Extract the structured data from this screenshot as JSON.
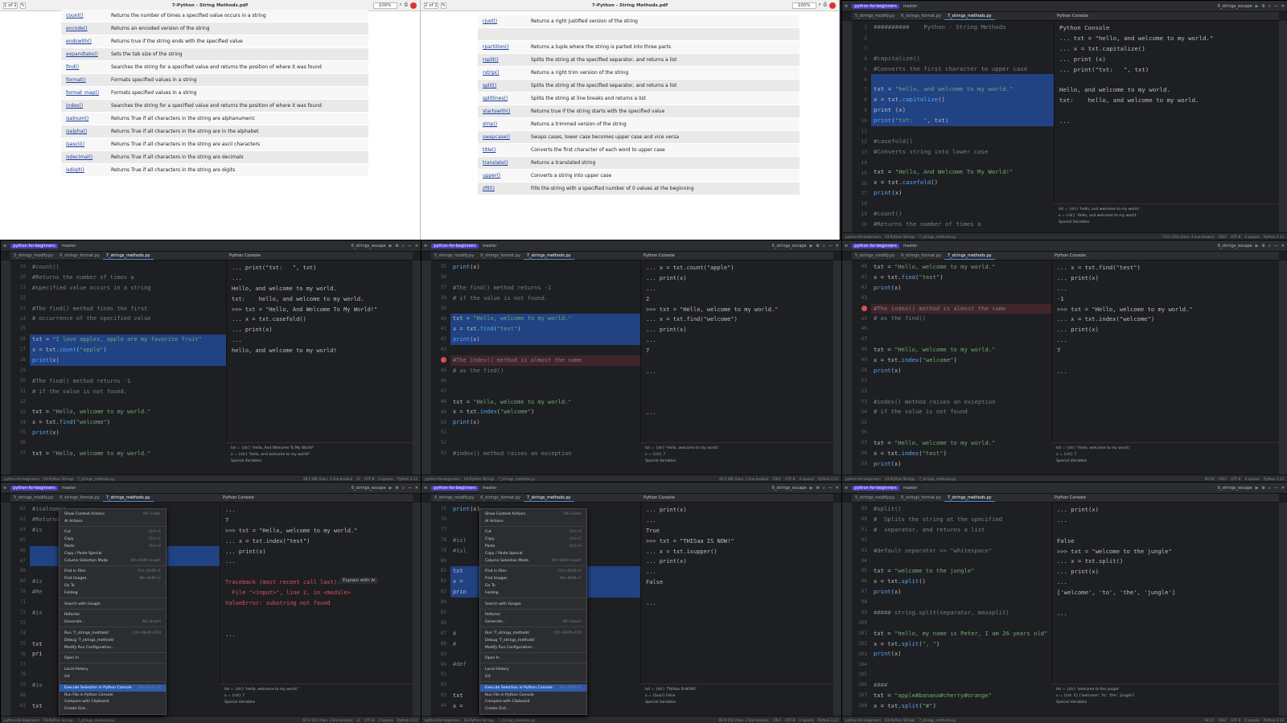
{
  "pdf1": {
    "title": "7-Python - String Methods.pdf",
    "zoom": "100%",
    "page": "1 of 2",
    "methods": [
      [
        "count()",
        "Returns the number of times a specified value occurs in a string"
      ],
      [
        "encode()",
        "Returns an encoded version of the string"
      ],
      [
        "endswith()",
        "Returns true if the string ends with the specified value"
      ],
      [
        "expandtabs()",
        "Sets the tab size of the string"
      ],
      [
        "find()",
        "Searches the string for a specified value and returns the position of where it was found"
      ],
      [
        "format()",
        "Formats specified values in a string"
      ],
      [
        "format_map()",
        "Formats specified values in a string"
      ],
      [
        "index()",
        "Searches the string for a specified value and returns the position of where it was found"
      ],
      [
        "isalnum()",
        "Returns True if all characters in the string are alphanumeric"
      ],
      [
        "isalpha()",
        "Returns True if all characters in the string are in the alphabet"
      ],
      [
        "isascii()",
        "Returns True if all characters in the string are ascii characters"
      ],
      [
        "isdecimal()",
        "Returns True if all characters in the string are decimals"
      ],
      [
        "isdigit()",
        "Returns True if all characters in the string are digits"
      ]
    ]
  },
  "pdf2": {
    "title": "7-Python - String Methods.pdf",
    "zoom": "100%",
    "page": "2 of 2",
    "methods": [
      [
        "rjust()",
        "Returns a right justified version of the string"
      ],
      [
        "",
        ""
      ],
      [
        "rpartition()",
        "Returns a tuple where the string is parted into three parts"
      ],
      [
        "rsplit()",
        "Splits the string at the specified separator, and returns a list"
      ],
      [
        "rstrip()",
        "Returns a right trim version of the string"
      ],
      [
        "split()",
        "Splits the string at the specified separator, and returns a list"
      ],
      [
        "splitlines()",
        "Splits the string at line breaks and returns a list"
      ],
      [
        "startswith()",
        "Returns true if the string starts with the specified value"
      ],
      [
        "strip()",
        "Returns a trimmed version of the string"
      ],
      [
        "swapcase()",
        "Swaps cases, lower case becomes upper case and vice versa"
      ],
      [
        "title()",
        "Converts the first character of each word to upper case"
      ],
      [
        "translate()",
        "Returns a translated string"
      ],
      [
        "upper()",
        "Converts a string into upper case"
      ],
      [
        "zfill()",
        "Fills the string with a specified number of 0 values at the beginning"
      ]
    ]
  },
  "ide_common": {
    "project": "python-for-beginners",
    "branch": "master",
    "run_config": "6_strings_escape",
    "tabs": [
      "5_strings_modify.py",
      "6_strings_format.py",
      "7_strings_methods.py"
    ],
    "console_tab": "Python Console",
    "special_vars": "Special Variables"
  },
  "panel1": {
    "lines": [
      {
        "n": "1",
        "t": "##########    Python - String Methods",
        "c": "cmt"
      },
      {
        "n": "2",
        "t": ""
      },
      {
        "n": "3",
        "t": ""
      },
      {
        "n": "4",
        "t": "#capitalize()",
        "c": "cmt"
      },
      {
        "n": "5",
        "t": "#Converts the first character to upper case",
        "c": "cmt"
      },
      {
        "n": "6",
        "t": "",
        "s": 1
      },
      {
        "n": "7",
        "t": "txt = \"hello, and welcome to my world.\"",
        "s": 1
      },
      {
        "n": "8",
        "t": "x = txt.capitalize()",
        "s": 1
      },
      {
        "n": "9",
        "t": "print (x)",
        "s": 1
      },
      {
        "n": "10",
        "t": "print(\"txt:   \", txt)",
        "s": 1
      },
      {
        "n": "11",
        "t": ""
      },
      {
        "n": "12",
        "t": "#casefold()",
        "c": "cmt"
      },
      {
        "n": "13",
        "t": "#Converts string into lower case",
        "c": "cmt"
      },
      {
        "n": "14",
        "t": ""
      },
      {
        "n": "15",
        "t": "txt = \"Hello, And Welcome To My World!\""
      },
      {
        "n": "16",
        "t": "x = txt.casefold()"
      },
      {
        "n": "17",
        "t": "print(x)"
      },
      {
        "n": "18",
        "t": ""
      },
      {
        "n": "19",
        "t": "#count()",
        "c": "cmt"
      },
      {
        "n": "20",
        "t": "#Returns the number of times a",
        "c": "cmt"
      }
    ],
    "console": [
      "Python Console",
      "... txt = \"hello, and welcome to my world.\"",
      "... x = txt.capitalize()",
      "... print (x)",
      "... print(\"txt:   \", txt)",
      "",
      "Hello, and welcome to my world.",
      "txt:    hello, and welcome to my world.",
      "",
      "..."
    ],
    "vars": [
      "txt = {str} 'hello, and welcome to my world.'",
      "x = {str} 'Hello, and welcome to my world.'",
      "Special Variables"
    ],
    "status": [
      "python-for-beginners",
      "03-Python Strings",
      "7_strings_methods.py",
      "7:52 (163 chars, 4 line breaks)",
      "CRLF",
      "UTF-8",
      "4 spaces",
      "Python 3.12"
    ]
  },
  "panel2": {
    "lines": [
      {
        "n": "19",
        "t": "#count()",
        "c": "cmt"
      },
      {
        "n": "20",
        "t": "#Returns the number of times a",
        "c": "cmt"
      },
      {
        "n": "21",
        "t": "#specified value occurs in a string",
        "c": "cmt"
      },
      {
        "n": "22",
        "t": ""
      },
      {
        "n": "23",
        "t": "#The find() method finds the first",
        "c": "cmt"
      },
      {
        "n": "24",
        "t": "# occurrence of the specified value",
        "c": "cmt"
      },
      {
        "n": "25",
        "t": ""
      },
      {
        "n": "26",
        "t": "txt = \"I love apples, apple are my favorite fruit\"",
        "s": 1
      },
      {
        "n": "27",
        "t": "x = txt.count(\"apple\")",
        "s": 1
      },
      {
        "n": "28",
        "t": "print(x)",
        "s": 1
      },
      {
        "n": "29",
        "t": ""
      },
      {
        "n": "30",
        "t": "#The find() method returns -1",
        "c": "cmt"
      },
      {
        "n": "31",
        "t": "# if the value is not found.",
        "c": "cmt"
      },
      {
        "n": "32",
        "t": ""
      },
      {
        "n": "33",
        "t": "txt = \"Hello, welcome to my world.\""
      },
      {
        "n": "34",
        "t": "x = txt.find(\"welcome\")"
      },
      {
        "n": "35",
        "t": "print(x)"
      },
      {
        "n": "36",
        "t": ""
      },
      {
        "n": "37",
        "t": "txt = \"Hello, welcome to my world.\""
      }
    ],
    "console": [
      "... print(\"txt:   \", txt)",
      "...",
      "Hello, and welcome to my world.",
      "txt:    hello, and welcome to my world.",
      ">>> txt = \"Hello, And Welcome To My World!\"",
      "... x = txt.casefold()",
      "... print(x)",
      "...",
      "hello, and welcome to my world!"
    ],
    "vars": [
      "txt = {str} 'Hello, And Welcome To My World!'",
      "x = {str} 'hello, and welcome to my world!'",
      "Special Variables"
    ],
    "status": [
      "python-for-beginners",
      "03-Python Strings",
      "7_strings_methods.py",
      "28:1 (80 chars, 3 line breaks)",
      "LF",
      "UTF-8",
      "4 spaces",
      "Python 3.12"
    ]
  },
  "panel3": {
    "lines": [
      {
        "n": "35",
        "t": "print(x)"
      },
      {
        "n": "36",
        "t": ""
      },
      {
        "n": "37",
        "t": "#The find() method returns -1",
        "c": "cmt"
      },
      {
        "n": "38",
        "t": "# if the value is not found.",
        "c": "cmt"
      },
      {
        "n": "39",
        "t": ""
      },
      {
        "n": "40",
        "t": "txt = \"Hello, welcome to my world.\"",
        "s": 1
      },
      {
        "n": "41",
        "t": "x = txt.find(\"test\")",
        "s": 1
      },
      {
        "n": "42",
        "t": "print(x)",
        "s": 1
      },
      {
        "n": "43",
        "t": ""
      },
      {
        "n": "44",
        "t": "#The index() method is almost the same",
        "c": "cmt",
        "b": 1
      },
      {
        "n": "45",
        "t": "# as the find()",
        "c": "cmt"
      },
      {
        "n": "46",
        "t": ""
      },
      {
        "n": "47",
        "t": ""
      },
      {
        "n": "48",
        "t": "txt = \"Hello, welcome to my world.\""
      },
      {
        "n": "49",
        "t": "x = txt.index(\"welcome\")"
      },
      {
        "n": "50",
        "t": "print(x)"
      },
      {
        "n": "51",
        "t": ""
      },
      {
        "n": "52",
        "t": ""
      },
      {
        "n": "53",
        "t": "#index() method raises an exception",
        "c": "cmt"
      }
    ],
    "console": [
      "... x = txt.count(\"apple\")",
      "... print(x)",
      "...",
      "2",
      ">>> txt = \"Hello, welcome to my world.\"",
      "... x = txt.find(\"welcome\")",
      "... print(x)",
      "...",
      "7",
      "",
      "...",
      "",
      "",
      "",
      "..."
    ],
    "vars": [
      "txt = {str} 'Hello, welcome to my world.'",
      "x = {int} 7",
      "Special Variables"
    ],
    "status": [
      "python-for-beginners",
      "03-Python Strings",
      "7_strings_methods.py",
      "40:1 (80 chars, 3 line breaks)",
      "CRLF",
      "UTF-8",
      "4 spaces",
      "Python 3.12"
    ]
  },
  "panel4": {
    "lines": [
      {
        "n": "40",
        "t": "txt = \"Hello, welcome to my world.\""
      },
      {
        "n": "41",
        "t": "x = txt.find(\"test\")"
      },
      {
        "n": "42",
        "t": "print(x)"
      },
      {
        "n": "43",
        "t": ""
      },
      {
        "n": "44",
        "t": "#The index() method is almost the same",
        "c": "cmt",
        "b": 1
      },
      {
        "n": "45",
        "t": "# as the find()",
        "c": "cmt"
      },
      {
        "n": "46",
        "t": ""
      },
      {
        "n": "47",
        "t": ""
      },
      {
        "n": "48",
        "t": "txt = \"Hello, welcome to my world.\""
      },
      {
        "n": "49",
        "t": "x = txt.index(\"welcome\")"
      },
      {
        "n": "50",
        "t": "print(x)"
      },
      {
        "n": "51",
        "t": ""
      },
      {
        "n": "52",
        "t": ""
      },
      {
        "n": "53",
        "t": "#index() method raises an exception",
        "c": "cmt"
      },
      {
        "n": "54",
        "t": "# if the value is not found",
        "c": "cmt"
      },
      {
        "n": "55",
        "t": ""
      },
      {
        "n": "56",
        "t": ""
      },
      {
        "n": "57",
        "t": "txt = \"Hello, welcome to my world.\""
      },
      {
        "n": "58",
        "t": "x = txt.index(\"test\")"
      },
      {
        "n": "59",
        "t": "print(x)"
      }
    ],
    "console": [
      "... x = txt.find(\"test\")",
      "... print(x)",
      "...",
      "-1",
      ">>> txt = \"Hello, welcome to my world.\"",
      "... x = txt.index(\"welcome\")",
      "... print(x)",
      "...",
      "7",
      "",
      "..."
    ],
    "vars": [
      "txt = {str} 'Hello, welcome to my world.'",
      "x = {int} 7",
      "Special Variables"
    ],
    "status": [
      "python-for-beginners",
      "03-Python Strings",
      "7_strings_methods.py",
      "49:18",
      "CRLF",
      "UTF-8",
      "4 spaces",
      "Python 3.12"
    ]
  },
  "panel5": {
    "lines": [
      {
        "n": "62",
        "t": "#isalnum()",
        "c": "cmt"
      },
      {
        "n": "63",
        "t": "#Returns True",
        "c": "cmt"
      },
      {
        "n": "64",
        "t": "#is",
        "c": "cmt"
      },
      {
        "n": "65",
        "t": ""
      },
      {
        "n": "66",
        "t": "",
        "s": 1
      },
      {
        "n": "67",
        "t": "",
        "s": 1
      },
      {
        "n": "68",
        "t": ""
      },
      {
        "n": "69",
        "t": "#is",
        "c": "cmt"
      },
      {
        "n": "70",
        "t": "#Re",
        "c": "cmt"
      },
      {
        "n": "71",
        "t": ""
      },
      {
        "n": "72",
        "t": "#is",
        "c": "cmt"
      },
      {
        "n": "73",
        "t": ""
      },
      {
        "n": "74",
        "t": ""
      },
      {
        "n": "75",
        "t": "txt"
      },
      {
        "n": "76",
        "t": "pri"
      },
      {
        "n": "77",
        "t": ""
      },
      {
        "n": "78",
        "t": ""
      },
      {
        "n": "79",
        "t": "#is",
        "c": "cmt"
      },
      {
        "n": "80",
        "t": ""
      },
      {
        "n": "81",
        "t": "txt"
      }
    ],
    "console": [
      "...",
      "7",
      ">>> txt = \"Hello, welcome to my world.\"",
      "... x = txt.index(\"test\")",
      "... print(x)",
      "...",
      "",
      "Traceback (most recent call last):",
      "  File \"<input>\", line 2, in <module>",
      "ValueError: substring not found",
      "",
      "",
      "...",
      ""
    ],
    "explain": "Explain with AI",
    "vars": [
      "txt = {str} 'Hello, welcome to my world.'",
      "x = {int} 7",
      "Special Variables"
    ],
    "status": [
      "python-for-beginners",
      "03-Python Strings",
      "7_strings_methods.py",
      "67:4 (41 chars, 3 line breaks)",
      "LF",
      "UTF-8",
      "4 spaces",
      "Python 3.12"
    ]
  },
  "panel6": {
    "lines": [
      {
        "n": "75",
        "t": "print(x)"
      },
      {
        "n": "76",
        "t": ""
      },
      {
        "n": "77",
        "t": ""
      },
      {
        "n": "78",
        "t": "#isl",
        "c": "cmt"
      },
      {
        "n": "79",
        "t": "#isl",
        "c": "cmt"
      },
      {
        "n": "80",
        "t": ""
      },
      {
        "n": "81",
        "t": "txt",
        "s": 1
      },
      {
        "n": "82",
        "t": "x =",
        "s": 1
      },
      {
        "n": "83",
        "t": "prin",
        "s": 1
      },
      {
        "n": "84",
        "t": ""
      },
      {
        "n": "85",
        "t": ""
      },
      {
        "n": "86",
        "t": ""
      },
      {
        "n": "87",
        "t": "# ",
        "c": "cmt"
      },
      {
        "n": "88",
        "t": "#",
        "c": "cmt"
      },
      {
        "n": "89",
        "t": ""
      },
      {
        "n": "90",
        "t": "#def",
        "c": "cmt"
      },
      {
        "n": "91",
        "t": ""
      },
      {
        "n": "92",
        "t": ""
      },
      {
        "n": "93",
        "t": "txt"
      },
      {
        "n": "94",
        "t": "x ="
      }
    ],
    "console": [
      "... print(x)",
      "...",
      "True",
      ">>> txt = \"THISaa IS NOW!\"",
      "... x = txt.isupper()",
      "... print(x)",
      "...",
      "False",
      "",
      "..."
    ],
    "vars": [
      "txt = {str} 'THISaa IS NOW!'",
      "x = {bool} False",
      "Special Variables"
    ],
    "status": [
      "python-for-beginners",
      "03-Python Strings",
      "7_strings_methods.py",
      "83:9 (54 chars, 2 line breaks)",
      "CRLF",
      "UTF-8",
      "4 spaces",
      "Python 3.12"
    ]
  },
  "panel7": {
    "lines": [
      {
        "n": "89",
        "t": "#split()",
        "c": "cmt"
      },
      {
        "n": "90",
        "t": "#  Splits the string at the specified",
        "c": "cmt"
      },
      {
        "n": "91",
        "t": "#  separator, and returns a list",
        "c": "cmt"
      },
      {
        "n": "92",
        "t": ""
      },
      {
        "n": "93",
        "t": "#default separator => \"whitespace\"",
        "c": "cmt"
      },
      {
        "n": "94",
        "t": ""
      },
      {
        "n": "95",
        "t": "txt = \"welcome to the jungle\""
      },
      {
        "n": "96",
        "t": "x = txt.split()"
      },
      {
        "n": "97",
        "t": "print(x)"
      },
      {
        "n": "98",
        "t": ""
      },
      {
        "n": "99",
        "t": "##### string.split(separator, maxsplit)",
        "c": "cmt"
      },
      {
        "n": "100",
        "t": ""
      },
      {
        "n": "101",
        "t": "txt = \"hello, my name is Peter, I am 26 years old\""
      },
      {
        "n": "102",
        "t": "x = txt.split(\", \")"
      },
      {
        "n": "103",
        "t": "print(x)"
      },
      {
        "n": "104",
        "t": ""
      },
      {
        "n": "105",
        "t": ""
      },
      {
        "n": "106",
        "t": "####",
        "c": "cmt"
      },
      {
        "n": "107",
        "t": "txt = \"apple#banana#cherry#orange\""
      },
      {
        "n": "108",
        "t": "x = txt.split(\"#\")"
      }
    ],
    "console": [
      "... print(x)",
      "...",
      "",
      "False",
      ">>> txt = \"welcome to the jungle\"",
      "... x = txt.split()",
      "... print(x)",
      "...",
      "['welcome', 'to', 'the', 'jungle']",
      "",
      "..."
    ],
    "vars": [
      "txt = {str} 'welcome to the jungle'",
      "x = {list: 4} ['welcome', 'to', 'the', 'jungle']",
      "Special Variables"
    ],
    "status": [
      "python-for-beginners",
      "03-Python Strings",
      "7_strings_methods.py",
      "94:15",
      "CRLF",
      "UTF-8",
      "4 spaces",
      "Python 3.12"
    ]
  },
  "menu": [
    {
      "l": "Show Context Actions",
      "k": "Alt+Enter"
    },
    {
      "l": "AI Actions",
      "k": ""
    },
    {
      "l": "",
      "k": ""
    },
    {
      "l": "Cut",
      "k": "Ctrl+X"
    },
    {
      "l": "Copy",
      "k": "Ctrl+C"
    },
    {
      "l": "Paste",
      "k": "Ctrl+V"
    },
    {
      "l": "Copy / Paste Special",
      "k": ""
    },
    {
      "l": "Column Selection Mode",
      "k": "Alt+Shift+Insert"
    },
    {
      "l": "",
      "k": ""
    },
    {
      "l": "Find in Files",
      "k": "Ctrl+Shift+F"
    },
    {
      "l": "Find Usages",
      "k": "Alt+Shift+7"
    },
    {
      "l": "Go To",
      "k": ""
    },
    {
      "l": "Folding",
      "k": ""
    },
    {
      "l": "",
      "k": ""
    },
    {
      "l": "Search with Google",
      "k": ""
    },
    {
      "l": "",
      "k": ""
    },
    {
      "l": "Refactor",
      "k": ""
    },
    {
      "l": "Generate...",
      "k": "Alt+Insert"
    },
    {
      "l": "",
      "k": ""
    },
    {
      "l": "Run '7_strings_methods'",
      "k": "Ctrl+Shift+F10"
    },
    {
      "l": "Debug '7_strings_methods'",
      "k": ""
    },
    {
      "l": "Modify Run Configuration...",
      "k": ""
    },
    {
      "l": "",
      "k": ""
    },
    {
      "l": "Open In",
      "k": ""
    },
    {
      "l": "",
      "k": ""
    },
    {
      "l": "Local History",
      "k": ""
    },
    {
      "l": "Git",
      "k": ""
    },
    {
      "l": "",
      "k": ""
    },
    {
      "l": "Execute Selection in Python Console",
      "k": "Alt+Shift+E",
      "h": 1
    },
    {
      "l": "Run File in Python Console",
      "k": ""
    },
    {
      "l": "Compare with Clipboard",
      "k": ""
    },
    {
      "l": "Create Gist...",
      "k": ""
    }
  ]
}
